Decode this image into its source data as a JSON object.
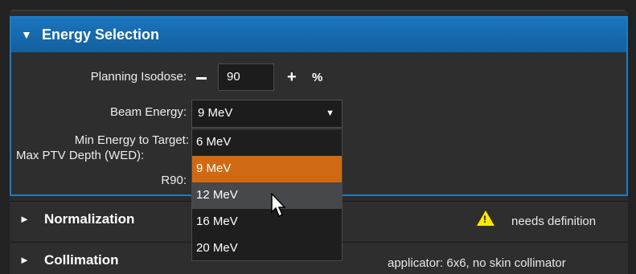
{
  "energy_panel": {
    "title": "Energy Selection",
    "planning_isodose_label": "Planning Isodose:",
    "planning_isodose_value": "90",
    "percent_unit": "%",
    "beam_energy_label": "Beam Energy:",
    "beam_energy_selected": "9 MeV",
    "min_energy_label": "Min Energy to Target:",
    "max_ptv_label": "Max PTV Depth (WED):",
    "r90_label": "R90:"
  },
  "dropdown": {
    "options": [
      "6 MeV",
      "9 MeV",
      "12 MeV",
      "16 MeV",
      "20 MeV"
    ],
    "selected": "9 MeV",
    "hovered": "12 MeV"
  },
  "normalization": {
    "title": "Normalization",
    "status": "needs definition",
    "status_icon": "warning-icon"
  },
  "collimation": {
    "title": "Collimation",
    "status": "applicator: 6x6, no skin collimator"
  },
  "colors": {
    "header_blue": "#1b75bd",
    "selected_orange": "#d06a12",
    "hover_gray": "#46484b",
    "warning_yellow": "#ffea00"
  }
}
